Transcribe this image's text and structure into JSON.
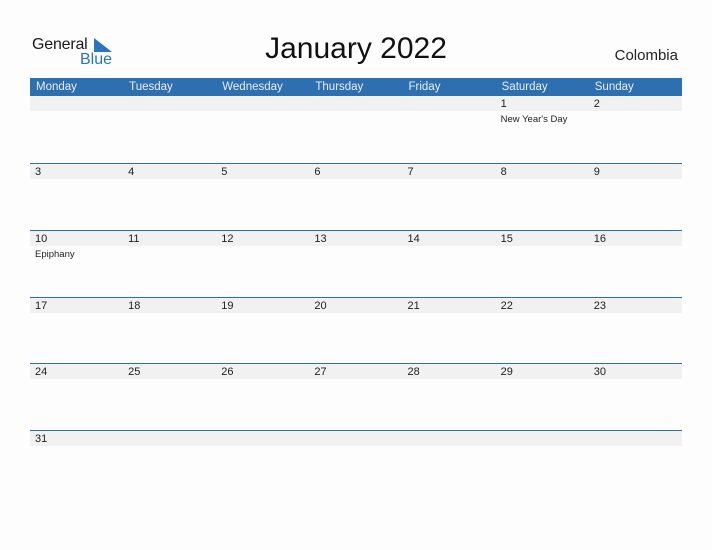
{
  "logo": {
    "word1": "General",
    "word2": "Blue",
    "icon": "triangle-flag-icon",
    "accent": "#2a75bb"
  },
  "title": "January 2022",
  "country": "Colombia",
  "header_color": "#2e6fb0",
  "weekdays": [
    "Monday",
    "Tuesday",
    "Wednesday",
    "Thursday",
    "Friday",
    "Saturday",
    "Sunday"
  ],
  "weeks": [
    {
      "days": [
        {
          "n": "",
          "h": ""
        },
        {
          "n": "",
          "h": ""
        },
        {
          "n": "",
          "h": ""
        },
        {
          "n": "",
          "h": ""
        },
        {
          "n": "",
          "h": ""
        },
        {
          "n": "1",
          "h": "New Year's Day"
        },
        {
          "n": "2",
          "h": ""
        }
      ]
    },
    {
      "days": [
        {
          "n": "3",
          "h": ""
        },
        {
          "n": "4",
          "h": ""
        },
        {
          "n": "5",
          "h": ""
        },
        {
          "n": "6",
          "h": ""
        },
        {
          "n": "7",
          "h": ""
        },
        {
          "n": "8",
          "h": ""
        },
        {
          "n": "9",
          "h": ""
        }
      ]
    },
    {
      "days": [
        {
          "n": "10",
          "h": "Epiphany"
        },
        {
          "n": "11",
          "h": ""
        },
        {
          "n": "12",
          "h": ""
        },
        {
          "n": "13",
          "h": ""
        },
        {
          "n": "14",
          "h": ""
        },
        {
          "n": "15",
          "h": ""
        },
        {
          "n": "16",
          "h": ""
        }
      ]
    },
    {
      "days": [
        {
          "n": "17",
          "h": ""
        },
        {
          "n": "18",
          "h": ""
        },
        {
          "n": "19",
          "h": ""
        },
        {
          "n": "20",
          "h": ""
        },
        {
          "n": "21",
          "h": ""
        },
        {
          "n": "22",
          "h": ""
        },
        {
          "n": "23",
          "h": ""
        }
      ]
    },
    {
      "days": [
        {
          "n": "24",
          "h": ""
        },
        {
          "n": "25",
          "h": ""
        },
        {
          "n": "26",
          "h": ""
        },
        {
          "n": "27",
          "h": ""
        },
        {
          "n": "28",
          "h": ""
        },
        {
          "n": "29",
          "h": ""
        },
        {
          "n": "30",
          "h": ""
        }
      ]
    },
    {
      "days": [
        {
          "n": "31",
          "h": ""
        },
        {
          "n": "",
          "h": ""
        },
        {
          "n": "",
          "h": ""
        },
        {
          "n": "",
          "h": ""
        },
        {
          "n": "",
          "h": ""
        },
        {
          "n": "",
          "h": ""
        },
        {
          "n": "",
          "h": ""
        }
      ]
    }
  ]
}
